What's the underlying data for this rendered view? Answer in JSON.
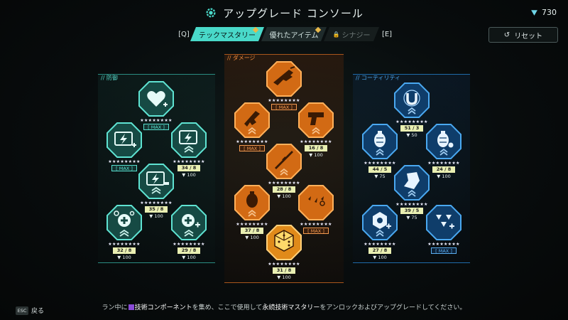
{
  "header": {
    "title": "アップグレード コンソール",
    "currency": "730"
  },
  "tabs": {
    "prev_key": "[Q]",
    "next_key": "[E]",
    "items": [
      {
        "label": "テックマスタリー",
        "state": "active"
      },
      {
        "label": "優れたアイテム",
        "state": "normal"
      },
      {
        "label": "シナジー",
        "state": "locked"
      }
    ]
  },
  "reset_label": "リセット",
  "panels": {
    "defense": "// 防御",
    "damage": "// ダメージ",
    "utility": "// コーティリティ"
  },
  "defense": {
    "heart": {
      "stars": "★★★★★★★★",
      "badge": "[ MAX ]"
    },
    "bolt_l": {
      "stars": "★★★★★★★★",
      "badge": "[ MAX ]"
    },
    "bolt_r": {
      "stars": "★★★★★★★★",
      "badge": "34 / 8",
      "cost": "100"
    },
    "bolt_m": {
      "stars": "★★★★★★★★",
      "badge": "35 / 8",
      "cost": "100"
    },
    "heal_l": {
      "stars": "★★★★★★★★",
      "badge": "32 / 8",
      "cost": "100"
    },
    "heal_r": {
      "stars": "★★★★★★★★",
      "badge": "29 / 8",
      "cost": "100"
    }
  },
  "damage": {
    "rifle": {
      "stars": "★★★★★★★★",
      "badge": "[ MAX ]"
    },
    "smg": {
      "stars": "★★★★★★★★",
      "badge": "[ MAX ]"
    },
    "pistol": {
      "stars": "★★★★★★★★",
      "badge": "16 / 8",
      "cost": "100"
    },
    "sniper": {
      "stars": "★★★★★★★★",
      "badge": "28 / 8",
      "cost": "100"
    },
    "grenade": {
      "stars": "★★★★★★★★",
      "badge": "37 / 8",
      "cost": "100"
    },
    "crit": {
      "stars": "★★★★★★★★",
      "badge": "[ MAX ]"
    },
    "dice": {
      "stars": "★★★★★★★★",
      "badge": "31 / 8",
      "cost": "100"
    }
  },
  "utility": {
    "magnet": {
      "stars": "★★★★★★★★",
      "badge": "51 / 3",
      "cost": "50"
    },
    "gren_l": {
      "stars": "★★★★★★★★",
      "badge": "44 / 5",
      "cost": "75"
    },
    "gren_r": {
      "stars": "★★★★★★★★",
      "badge": "24 / 8",
      "cost": "100"
    },
    "shard": {
      "stars": "★★★★★★★★",
      "badge": "39 / 5",
      "cost": "75"
    },
    "bolt": {
      "stars": "★★★★★★★★",
      "badge": "27 / 8",
      "cost": "100"
    },
    "triangle": {
      "stars": "★★★★★★★★",
      "badge": "[ MAX ]"
    }
  },
  "footer": {
    "esc_key": "ESC",
    "esc_label": "戻る",
    "hint_1": "ラン中に",
    "hint_2": "技術コンポーネント",
    "hint_3": "を集め、ここで使用して",
    "hint_4": "永続技術マスタリー",
    "hint_5": "をアンロックおよびアップグレードしてください。"
  },
  "colors": {
    "teal": "#49d9c9",
    "orange": "#f08a3a",
    "blue": "#3a9be8",
    "max_badge": "#e9efb2"
  }
}
